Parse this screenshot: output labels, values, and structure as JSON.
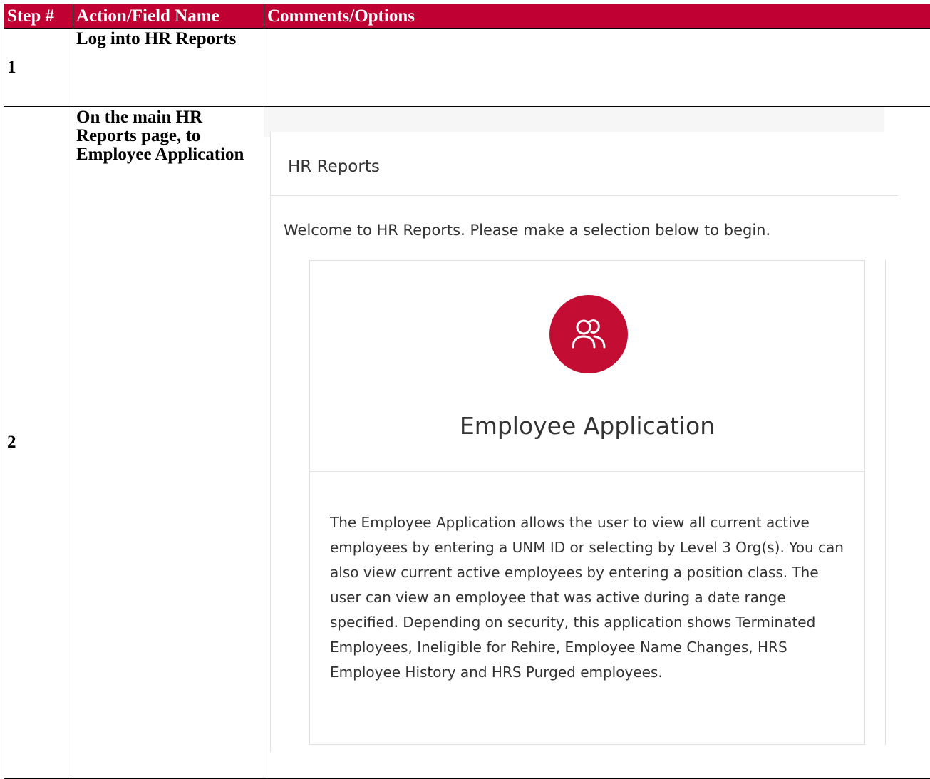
{
  "table": {
    "headers": {
      "step": "Step #",
      "action": "Action/Field Name",
      "comments": "Comments/Options"
    },
    "rows": [
      {
        "step": "1",
        "action": "Log into HR Reports"
      },
      {
        "step": "2",
        "action": "On the main HR Reports page, to Employee Application"
      }
    ]
  },
  "screenshot": {
    "page_title": "HR Reports",
    "welcome_text": "Welcome to HR Reports. Please make a selection below to begin.",
    "card": {
      "icon": "users-icon",
      "title": "Employee Application",
      "description": "The Employee Application allows the user to view all current active employees by entering a UNM ID or selecting by Level 3 Org(s). You can also view current active employees by entering a position class. The user can view an employee that was active during a date range specified. Depending on security, this application shows Terminated Employees, Ineligible for Rehire, Employee Name Changes, HRS Employee History and HRS Purged employees."
    }
  },
  "colors": {
    "header_bg": "#c00033",
    "header_text": "#ffffff",
    "icon_circle": "#c40d33"
  }
}
